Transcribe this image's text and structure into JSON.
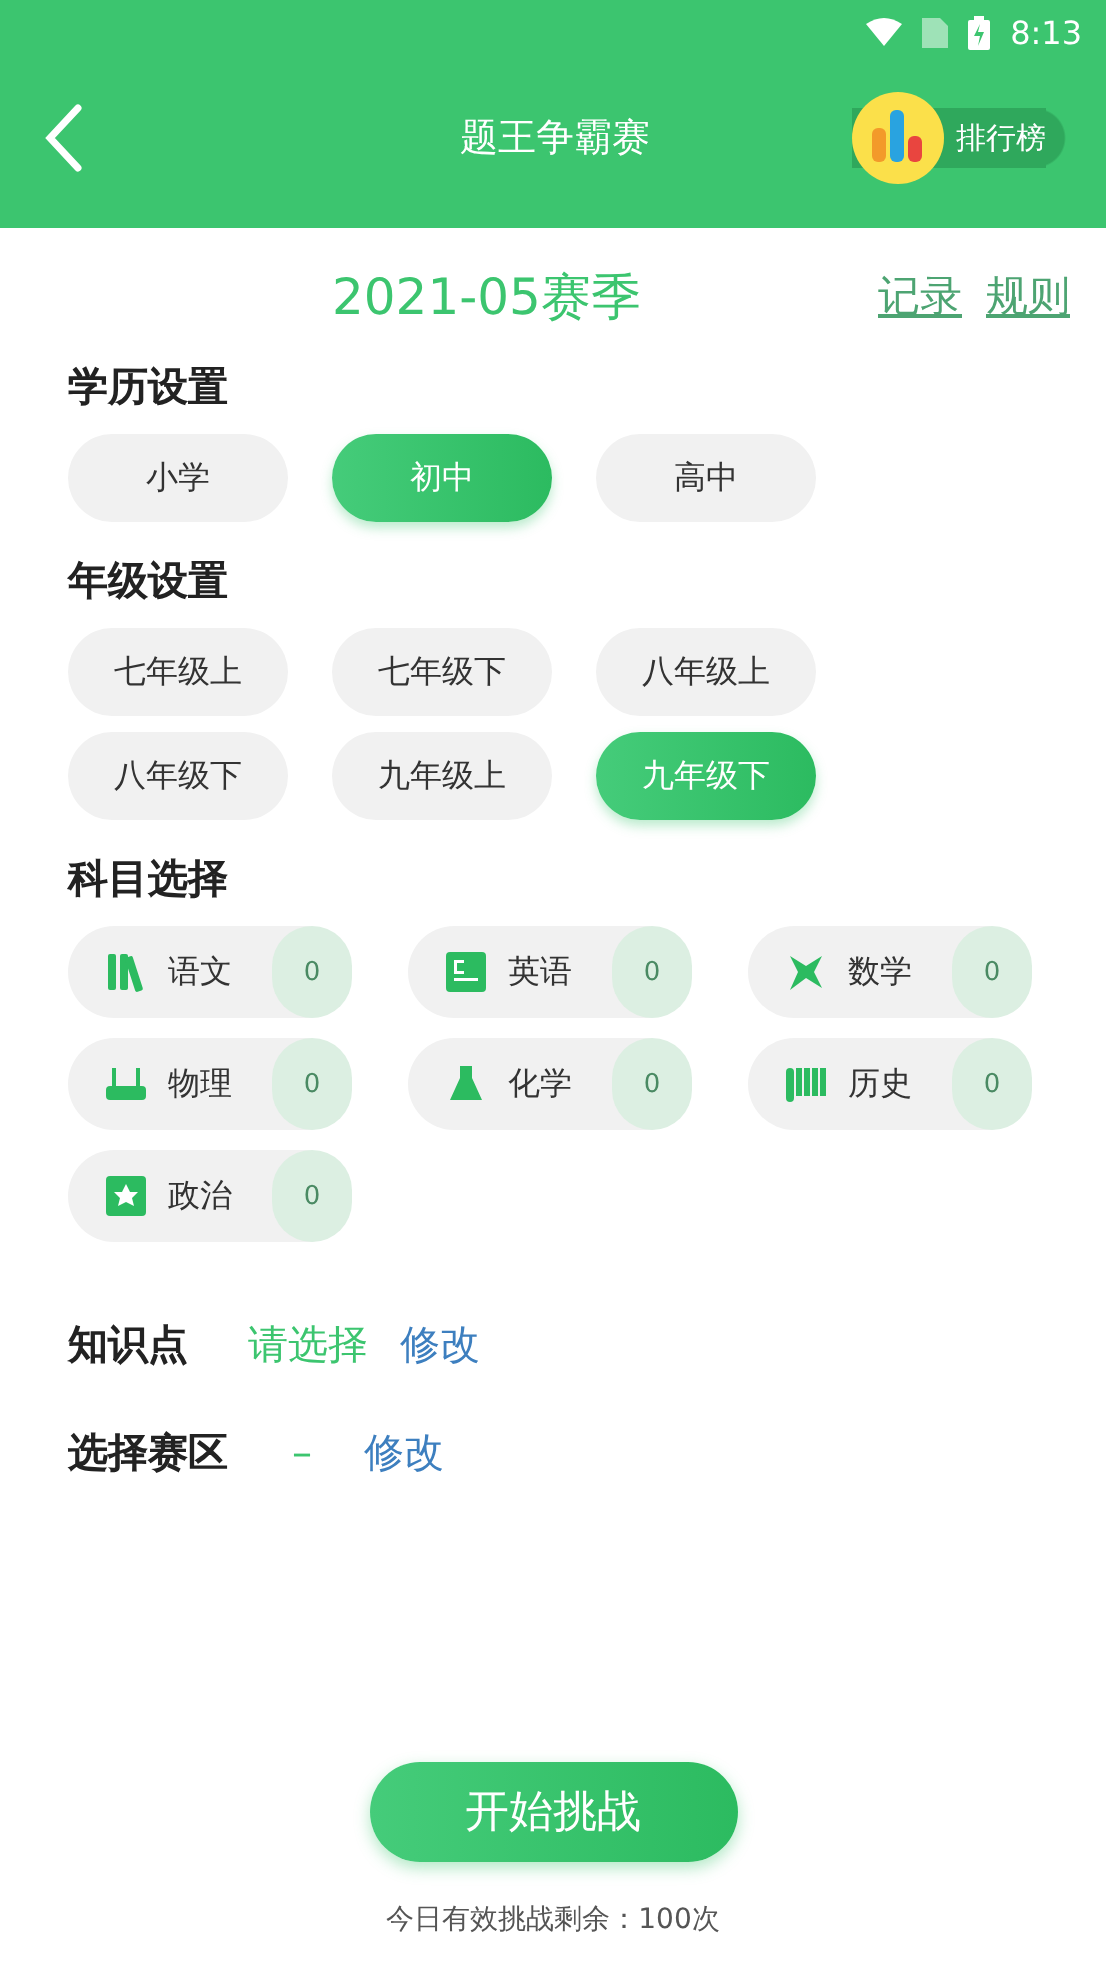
{
  "status_bar": {
    "time": "8:13"
  },
  "header": {
    "title": "题王争霸赛",
    "ranking_label": "排行榜"
  },
  "season": {
    "title": "2021-05赛季",
    "links": [
      "记录",
      "规则"
    ]
  },
  "education": {
    "title": "学历设置",
    "options": [
      {
        "label": "小学",
        "selected": false
      },
      {
        "label": "初中",
        "selected": true
      },
      {
        "label": "高中",
        "selected": false
      }
    ]
  },
  "grade": {
    "title": "年级设置",
    "options": [
      {
        "label": "七年级上",
        "selected": false
      },
      {
        "label": "七年级下",
        "selected": false
      },
      {
        "label": "八年级上",
        "selected": false
      },
      {
        "label": "八年级下",
        "selected": false
      },
      {
        "label": "九年级上",
        "selected": false
      },
      {
        "label": "九年级下",
        "selected": true
      }
    ]
  },
  "subjects": {
    "title": "科目选择",
    "items": [
      {
        "label": "语文",
        "count": "0"
      },
      {
        "label": "英语",
        "count": "0"
      },
      {
        "label": "数学",
        "count": "0"
      },
      {
        "label": "物理",
        "count": "0"
      },
      {
        "label": "化学",
        "count": "0"
      },
      {
        "label": "历史",
        "count": "0"
      },
      {
        "label": "政治",
        "count": "0"
      }
    ]
  },
  "knowledge": {
    "label": "知识点",
    "value": "请选择",
    "action": "修改"
  },
  "region": {
    "label": "选择赛区",
    "value": "–",
    "action": "修改"
  },
  "start_button": "开始挑战",
  "remaining": "今日有效挑战剩余：100次"
}
